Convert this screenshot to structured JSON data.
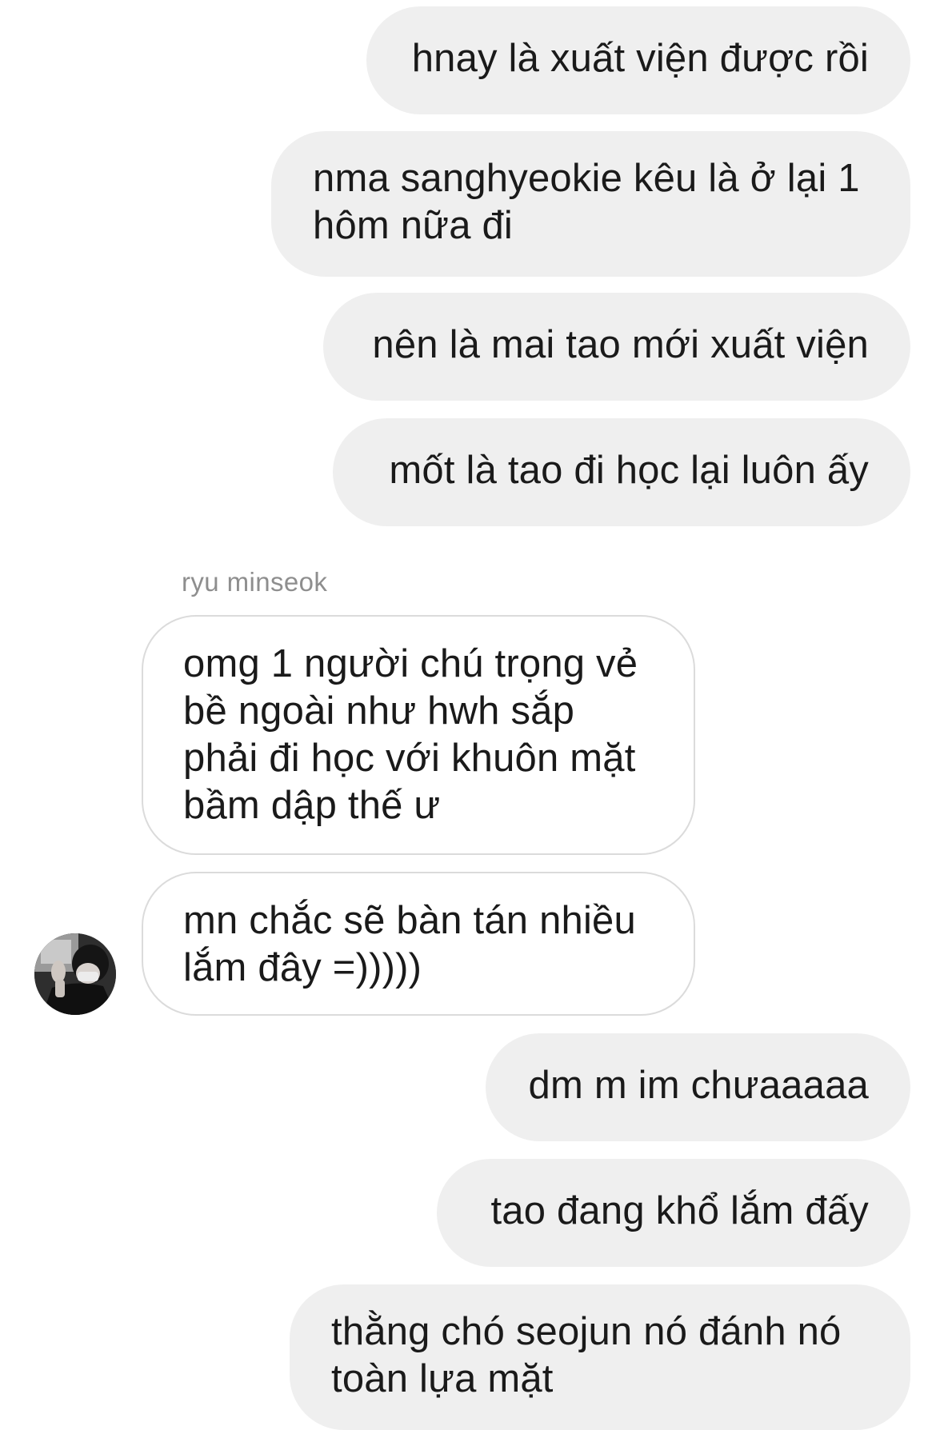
{
  "messages": {
    "m1": "hnay là xuất viện được rồi",
    "m2": "nma sanghyeokie kêu là ở lại 1\nhôm nữa đi",
    "m3": "nên là mai tao mới xuất viện",
    "m4": "mốt là tao đi học lại luôn ấy",
    "m5": "omg 1 người chú trọng vẻ\nbề ngoài như hwh sắp\nphải đi học với khuôn mặt\nbầm dập thế ư",
    "m6": "mn chắc sẽ bàn tán nhiều\nlắm đây =)))))",
    "m7": "dm m im chưaaaaa",
    "m8": "tao đang khổ lắm đấy",
    "m9": "thằng chó seojun nó đánh nó\ntoàn lựa mặt"
  },
  "sender_name": "ryu minseok",
  "colors": {
    "outgoing_bubble": "#efefef",
    "incoming_border": "#dbdbdb",
    "sender_name": "#8e8e8e",
    "text": "#1a1a1a"
  },
  "icons": {
    "avatar": "profile-photo"
  }
}
